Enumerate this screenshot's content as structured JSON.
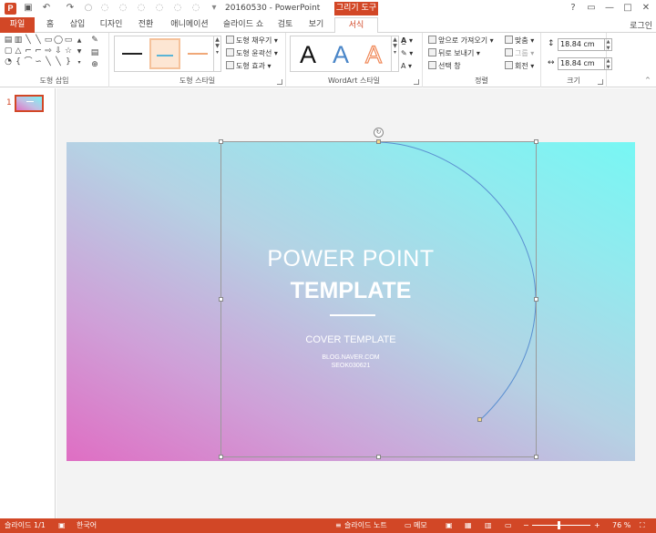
{
  "titlebar": {
    "app_icon": "P",
    "document_title": "20160530 - PowerPoint",
    "context_group": "그리기 도구",
    "qat": [
      "save-icon",
      "undo-icon",
      "redo-icon"
    ],
    "window_buttons": [
      "?",
      "▭",
      "—",
      "□",
      "✕"
    ]
  },
  "tabs": [
    "파일",
    "홈",
    "삽입",
    "디자인",
    "전환",
    "애니메이션",
    "슬라이드 쇼",
    "검토",
    "보기",
    "서식"
  ],
  "login_label": "로그인",
  "ribbon": {
    "groups": {
      "insert_shapes": "도형 삽입",
      "shape_styles": "도형 스타일",
      "wordart_styles": "WordArt 스타일",
      "arrange": "정렬",
      "size": "크기"
    },
    "shape_style_cmds": [
      "도형 채우기",
      "도형 윤곽선",
      "도형 효과"
    ],
    "arrange_cmds": [
      "앞으로 가져오기",
      "뒤로 보내기",
      "선택 창"
    ],
    "align_cmds": [
      "맞춤",
      "그룹",
      "회전"
    ],
    "height_value": "18.84 cm",
    "width_value": "18.84 cm",
    "wordart_letter": "A",
    "colors": {
      "accent": "#d24726",
      "style_line_1": "#222222",
      "style_line_2": "#5ab4d6",
      "style_line_3": "#f0a878",
      "wordart_1": "#111111",
      "wordart_2": "#4a86c8",
      "wordart_3": "#f08a5a"
    }
  },
  "thumbnail_pane": {
    "slide_number": "1"
  },
  "slide": {
    "title_line1": "POWER POINT",
    "title_line2": "TEMPLATE",
    "subtitle": "COVER TEMPLATE",
    "small_line1": "BLOG.NAVER.COM",
    "small_line2": "SEOK030621"
  },
  "statusbar": {
    "slide_counter": "슬라이드 1/1",
    "language": "한국어",
    "notes": "슬라이드 노트",
    "comments": "메모",
    "zoom_label": "76 %"
  }
}
